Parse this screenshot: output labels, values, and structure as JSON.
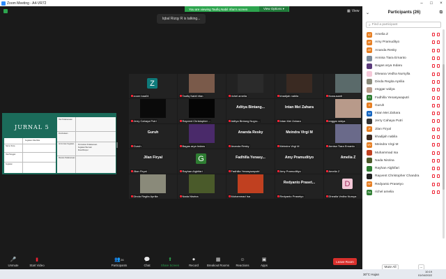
{
  "window": {
    "title": "Zoom Meeting - A4-VR72"
  },
  "share": {
    "banner": "You are viewing Taufiq Nabil Irfan's screen",
    "view_options": "View Options ▾",
    "view_btn": "View"
  },
  "talking": "Iqbal Rizqy R is talking...",
  "slide": {
    "title": "JURNAL 5",
    "left_head": [
      "Kegiatan Nilai-Nilai",
      "Nama Anak"
    ],
    "left_rows": [
      "Nama Tema",
      "Hari/Tanggal",
      "Kegiatan"
    ],
    "right_head": [
      "Hari Pelaksanaan",
      "Pembukaan",
      "Inti & Isian Kegiatan",
      "Metode Pelaksanaan"
    ],
    "bullets": [
      "Permainan Pelaksanaan",
      "Kegiatan Bermain",
      "Mural/Simpul"
    ]
  },
  "tiles": [
    {
      "name": "zoom baa04",
      "type": "avatar",
      "letter": "Z",
      "color": "#0e7a7a"
    },
    {
      "name": "Taufiq Nabil Irfan",
      "type": "photo",
      "color": "#7a5a4a"
    },
    {
      "name": "richel amelia",
      "type": "photo",
      "color": "#2b2b2b"
    },
    {
      "name": "khadijah nabila",
      "type": "photo",
      "color": "#3a2a22"
    },
    {
      "name": "Kussusanti",
      "type": "photo",
      "color": "#5a6a6a"
    },
    {
      "name": "Jerry Cahaya Putri",
      "type": "photo",
      "color": "#0a0a0a"
    },
    {
      "name": "Rayvent Christopher ...",
      "type": "photo",
      "color": "#050505"
    },
    {
      "name": "Aditya Bintang Nugro...",
      "type": "text",
      "big": "Aditya  Bintang..."
    },
    {
      "name": "Intan Mei Zahara",
      "type": "text",
      "big": "Intan Mei Zahara"
    },
    {
      "name": "enggar widya",
      "type": "photo",
      "color": "#b89a8a"
    },
    {
      "name": "Guruh",
      "type": "text",
      "big": "Guruh"
    },
    {
      "name": "Bagas arya Indaru",
      "type": "photo",
      "color": "#4a2a6a"
    },
    {
      "name": "Ananda Resky",
      "type": "text",
      "big": "Ananda Resky"
    },
    {
      "name": "Meindra Virgi M",
      "type": "text",
      "big": "Meindra Virgi M"
    },
    {
      "name": "Annisa Tiara Ernanto",
      "type": "photo",
      "color": "#6a6a8a"
    },
    {
      "name": "Jilan Firyal",
      "type": "text",
      "big": "Jilan Firyal"
    },
    {
      "name": "Rayhan Alghifari",
      "type": "avatar",
      "letter": "G",
      "color": "#2e7d32"
    },
    {
      "name": "Fadhilla Yenasywaputri",
      "type": "text",
      "big": "Fadhilla Yenasy..."
    },
    {
      "name": "Amy Pramuditiyo",
      "type": "text",
      "big": "Amy Pramudityo"
    },
    {
      "name": "Amelia Z",
      "type": "text",
      "big": "Amelia Z"
    },
    {
      "name": "Dinda Regita Aprilia",
      "type": "photo",
      "color": "#8a8a7a"
    },
    {
      "name": "Nada Nisrina",
      "type": "photo",
      "color": "#4a5a2a"
    },
    {
      "name": "Muhammad Isa",
      "type": "photo",
      "color": "#c04020"
    },
    {
      "name": "Redyanto Prasetyo",
      "type": "text",
      "big": "Redyanto Praset..."
    },
    {
      "name": "Dhealla Vedha Nursya",
      "type": "avatar",
      "letter": "D",
      "color": "#f4c8d8"
    }
  ],
  "toolbar": {
    "unmute": "Unmute",
    "start_video": "Start Video",
    "participants": "Participants",
    "participants_count": "26",
    "chat": "Chat",
    "share_screen": "Share Screen",
    "record": "Record",
    "breakout": "Breakout Rooms",
    "reactions": "Reactions",
    "apps": "Apps",
    "leave": "Leave Room"
  },
  "panel": {
    "title": "Participants (26)",
    "search_placeholder": "Find a participant",
    "mute_all": "Mute All",
    "more": "...",
    "participants": [
      {
        "name": "Amelia Z",
        "initials": "AZ",
        "color": "#e67e22"
      },
      {
        "name": "Amy Pramudityo",
        "initials": "AP",
        "color": "#e67e22"
      },
      {
        "name": "Ananda Resky",
        "initials": "AR",
        "color": "#e67e22"
      },
      {
        "name": "Annisa Tiara Ernanto",
        "initials": "",
        "color": "#7a8a9a"
      },
      {
        "name": "Bagas arya Indaru",
        "initials": "",
        "color": "#5a3a7a"
      },
      {
        "name": "Dheana Vedha Nursylla",
        "initials": "",
        "color": "#f4c8d8"
      },
      {
        "name": "Dinda Regita Aprilia",
        "initials": "",
        "color": "#8a8a7a"
      },
      {
        "name": "enggar widya",
        "initials": "",
        "color": "#b89a8a"
      },
      {
        "name": "Fadhilla Yenasywaputri",
        "initials": "FY",
        "color": "#2e7d32"
      },
      {
        "name": "Guruh",
        "initials": "G",
        "color": "#e67e22"
      },
      {
        "name": "Intan Mei Zahara",
        "initials": "IM",
        "color": "#1565c0"
      },
      {
        "name": "Jerry Cahaya Putri",
        "initials": "",
        "color": "#333333"
      },
      {
        "name": "Jilan Firyal",
        "initials": "JF",
        "color": "#e67e22"
      },
      {
        "name": "khadijah nabila",
        "initials": "",
        "color": "#3a2a22"
      },
      {
        "name": "Meindra Virgi M",
        "initials": "MV",
        "color": "#e67e22"
      },
      {
        "name": "Muhammad Isa",
        "initials": "",
        "color": "#c04020"
      },
      {
        "name": "Nada Nisrina",
        "initials": "",
        "color": "#4a5a2a"
      },
      {
        "name": "Rayhan Alghifari",
        "initials": "",
        "color": "#2e7d32"
      },
      {
        "name": "Rayvent Christopher Chandra",
        "initials": "",
        "color": "#222222"
      },
      {
        "name": "Redyanto Prasetyo",
        "initials": "RP",
        "color": "#e67e22"
      },
      {
        "name": "richel amelia",
        "initials": "RA",
        "color": "#2e7d32"
      }
    ]
  },
  "taskbar": {
    "weather": "30°C  Hujan",
    "time": "10:19",
    "date": "01/04/2022"
  }
}
